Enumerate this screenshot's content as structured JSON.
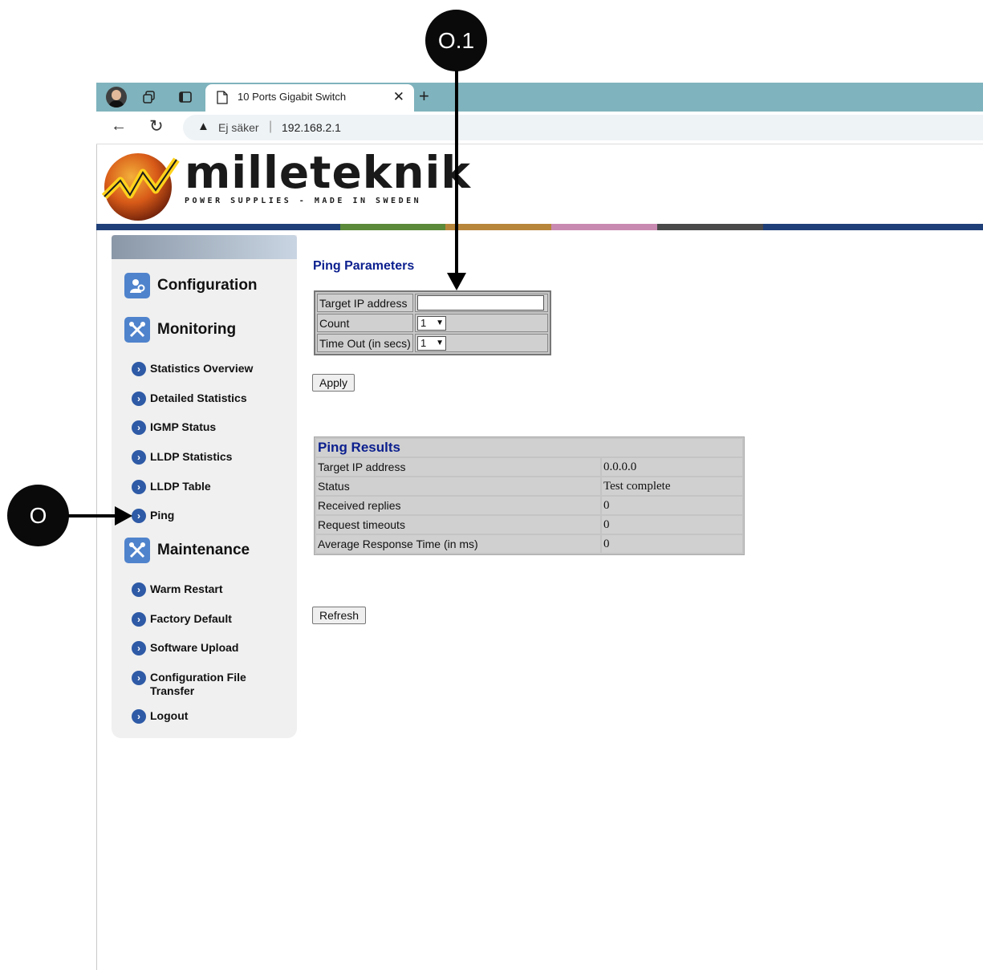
{
  "browser": {
    "tab_title": "10 Ports Gigabit Switch",
    "security_label": "Ej säker",
    "address": "192.168.2.1"
  },
  "logo": {
    "wordmark": "milleteknik",
    "tagline": "POWER SUPPLIES - MADE IN SWEDEN"
  },
  "colors": {
    "tabbar": "#7fb3bd",
    "bar_segments": [
      "#1f3f78",
      "#5b8a3a",
      "#b8863b",
      "#c88ab0",
      "#4a4a4a",
      "#1f3f78"
    ],
    "heading": "#0b1f8e",
    "nav_icon": "#2e5aa6"
  },
  "sidebar": {
    "sections": [
      {
        "label": "Configuration",
        "icon": "config-icon"
      },
      {
        "label": "Monitoring",
        "icon": "tools-icon"
      },
      {
        "label": "Maintenance",
        "icon": "tools-icon"
      }
    ],
    "monitoring_items": [
      "Statistics Overview",
      "Detailed Statistics",
      "IGMP Status",
      "LLDP Statistics",
      "LLDP Table",
      "Ping"
    ],
    "maintenance_items": [
      "Warm Restart",
      "Factory Default",
      "Software Upload",
      "Configuration File Transfer",
      "Logout"
    ]
  },
  "ping_parameters": {
    "title": "Ping Parameters",
    "target_label": "Target IP address",
    "target_value": "",
    "count_label": "Count",
    "count_value": "1",
    "timeout_label": "Time Out (in secs)",
    "timeout_value": "1",
    "apply_label": "Apply"
  },
  "ping_results": {
    "title": "Ping Results",
    "rows": [
      {
        "label": "Target IP address",
        "value": "0.0.0.0"
      },
      {
        "label": "Status",
        "value": "Test complete"
      },
      {
        "label": "Received replies",
        "value": "0"
      },
      {
        "label": "Request timeouts",
        "value": "0"
      },
      {
        "label": "Average Response Time (in ms)",
        "value": "0"
      }
    ],
    "refresh_label": "Refresh"
  },
  "annotations": {
    "callout_ping": "O",
    "callout_target": "O.1"
  }
}
